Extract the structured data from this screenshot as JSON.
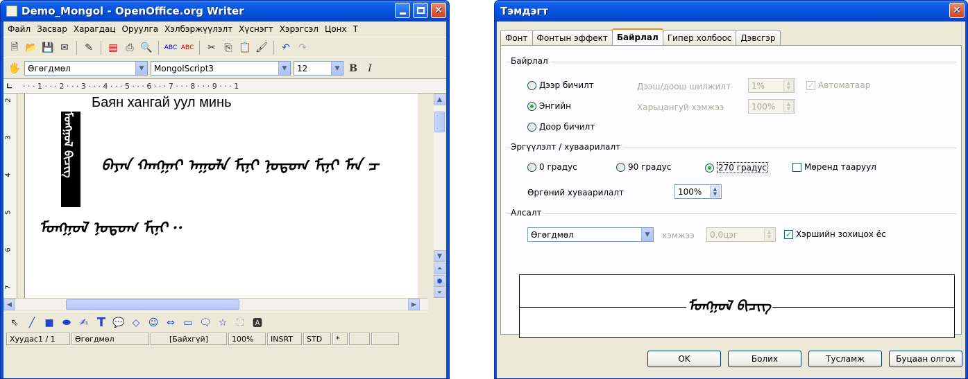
{
  "writer": {
    "title": "Demo_Mongol - OpenOffice.org Writer",
    "menu": [
      "Файл",
      "Засвар",
      "Харагдац",
      "Оруулга",
      "Хэлбэржүүлэлт",
      "Хүснэгт",
      "Хэрэгсэл",
      "Цонх",
      "Т"
    ],
    "format_toolbar": {
      "style": "Өгөгдмөл",
      "font": "MongolScript3",
      "size": "12",
      "bold": "B",
      "italic": "I"
    },
    "ruler_numbers": "· · · 1 · · · 2 · · · 3 · · · 4 · · · 5 · · · 6 · · · 7 · · · 8 · · · 9 · · · 1",
    "vertical_ruler": [
      "2",
      "3",
      "4",
      "5",
      "6",
      "7"
    ],
    "document": {
      "heading": "Баян хангай уул минь",
      "vertical_text": "ᠮᠣᠩᠭᠣᠯ ᠪᠢᠴᠢᠭ",
      "line1": "ᠪᠠᠶᠠᠨ ᠬᠠᠩᠭᠠᠢ ᠠᠭᠤᠯᠠ ᠮᠢᠨᠢ ᠨᠤᠲᠤᠭ ᠮᠢᠨᠢ ᠮᠠᠨ ᠴ",
      "line2": "ᠮᠣᠩᠭᠣᠯ ᠨᠤᠲᠤᠭ ᠮᠢᠨᠢ ··"
    },
    "status": {
      "page": "Хуудас1 / 1",
      "style": "Өгөгдмөл",
      "language": "[Байхгүй]",
      "zoom": "100%",
      "insert": "INSRT",
      "selection": "STD",
      "modified": "*"
    }
  },
  "dialog": {
    "title": "Тэмдэгт",
    "tabs": [
      "Фонт",
      "Фонтын эффект",
      "Байрлал",
      "Гипер холбоос",
      "Дэвсгэр"
    ],
    "active_tab": "Байрлал",
    "position": {
      "label": "Байрлал",
      "superscript": "Дээр бичилт",
      "normal": "Энгийн",
      "subscript": "Доор бичилт",
      "raise_lower_label": "Дээш/доош шилжилт",
      "raise_lower_value": "1%",
      "automatic": "Автоматаар",
      "relative_size_label": "Харьцангуй хэмжээ",
      "relative_size_value": "100%"
    },
    "rotation": {
      "label": "Эргүүлэлт / хуваарилалт",
      "deg0": "0 градус",
      "deg90": "90 градус",
      "deg270": "270 градус",
      "fit_to_line": "Мөренд тааруул",
      "scale_width_label": "Өргөний хуваарилалт",
      "scale_width_value": "100%"
    },
    "spacing": {
      "label": "Алсалт",
      "mode": "Өгөгдмөл",
      "by_label": "хэмжээ",
      "by_value": "0,0цэг",
      "pair_kerning": "Хэршийн зохицох ёс"
    },
    "preview_text": "ᠮᠣᠩᠭᠣᠯ ᠪᠢᠴᠢᠭ",
    "buttons": {
      "ok": "OK",
      "cancel": "Болих",
      "help": "Тусламж",
      "reset": "Буцаан олгох"
    }
  }
}
